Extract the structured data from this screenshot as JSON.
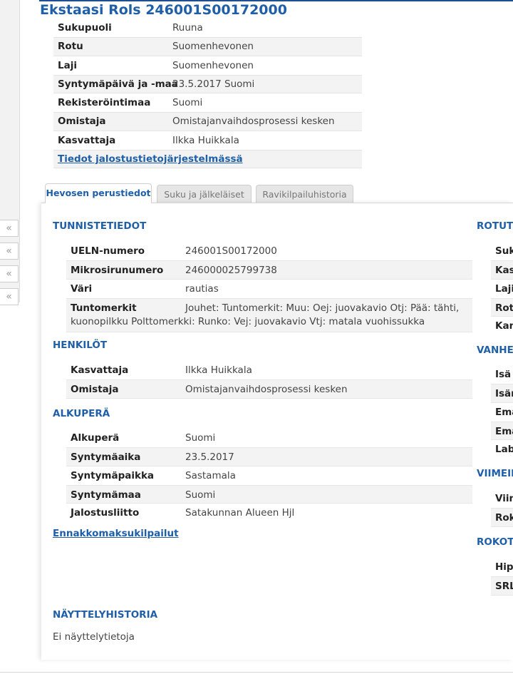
{
  "horse": {
    "title": "Ekstaasi Rols 246001S00172000"
  },
  "summary": {
    "rows": [
      {
        "label": "Sukupuoli",
        "value": "Ruuna"
      },
      {
        "label": "Rotu",
        "value": "Suomenhevonen"
      },
      {
        "label": "Laji",
        "value": "Suomenhevonen"
      },
      {
        "label": "Syntymäpäivä ja -maa",
        "value": "23.5.2017 Suomi"
      },
      {
        "label": "Rekisteröintimaa",
        "value": "Suomi"
      },
      {
        "label": "Omistaja",
        "value": "Omistajanvaihdosprosessi kesken"
      },
      {
        "label": "Kasvattaja",
        "value": "Ilkka Huikkala"
      }
    ],
    "link": "Tiedot jalostustietojärjestelmässä"
  },
  "collapse_tabs": [
    "«",
    "«",
    "«",
    "«"
  ],
  "tabs": [
    {
      "label": "Hevosen perustiedot",
      "active": true
    },
    {
      "label": "Suku ja jälkeläiset",
      "active": false
    },
    {
      "label": "Ravikilpailuhistoria",
      "active": false
    }
  ],
  "tunniste": {
    "heading": "TUNNISTETIEDOT",
    "rows": [
      {
        "label": "UELN-numero",
        "value": "246001S00172000"
      },
      {
        "label": "Mikrosirunumero",
        "value": "246000025799738"
      },
      {
        "label": "Väri",
        "value": "rautias"
      }
    ],
    "marks_label": "Tuntomerkit",
    "marks_line1": "Jouhet: Tuntomerkit: Muu: Oej: juovakavio Otj: Pää: tähti,",
    "marks_line2": "kuonopilkku Polttomerkki: Runko: Vej: juovakavio Vtj: matala vuohissukka"
  },
  "henkilot": {
    "heading": "HENKILÖT",
    "rows": [
      {
        "label": "Kasvattaja",
        "value": "Ilkka Huikkala"
      },
      {
        "label": "Omistaja",
        "value": "Omistajanvaihdosprosessi kesken"
      }
    ]
  },
  "alkupera": {
    "heading": "ALKUPERÄ",
    "rows": [
      {
        "label": "Alkuperä",
        "value": "Suomi"
      },
      {
        "label": "Syntymäaika",
        "value": "23.5.2017"
      },
      {
        "label": "Syntymäpaikka",
        "value": "Sastamala"
      },
      {
        "label": "Syntymämaa",
        "value": "Suomi"
      },
      {
        "label": "Jalostusliitto",
        "value": "Satakunnan Alueen Hjl"
      }
    ]
  },
  "ennakko_link": "Ennakkomaksukilpailut",
  "nayttely": {
    "heading": "NÄYTTELYHISTORIA",
    "text": "Ei näyttelytietoja"
  },
  "right_column": {
    "sections": [
      {
        "heading": "ROTUTI",
        "rows": [
          "Suk",
          "Kas",
          "Laji",
          "Rotu",
          "Kan"
        ]
      },
      {
        "heading": "VANHE",
        "rows": [
          "Isä",
          "Isän",
          "Emä",
          "Emä",
          "Labe"
        ]
      },
      {
        "heading": "VIIMEIN",
        "rows": [
          "Viim",
          "Rok"
        ]
      },
      {
        "heading": "ROKOTU",
        "rows": [
          "Hipp",
          "SRL"
        ]
      }
    ]
  }
}
